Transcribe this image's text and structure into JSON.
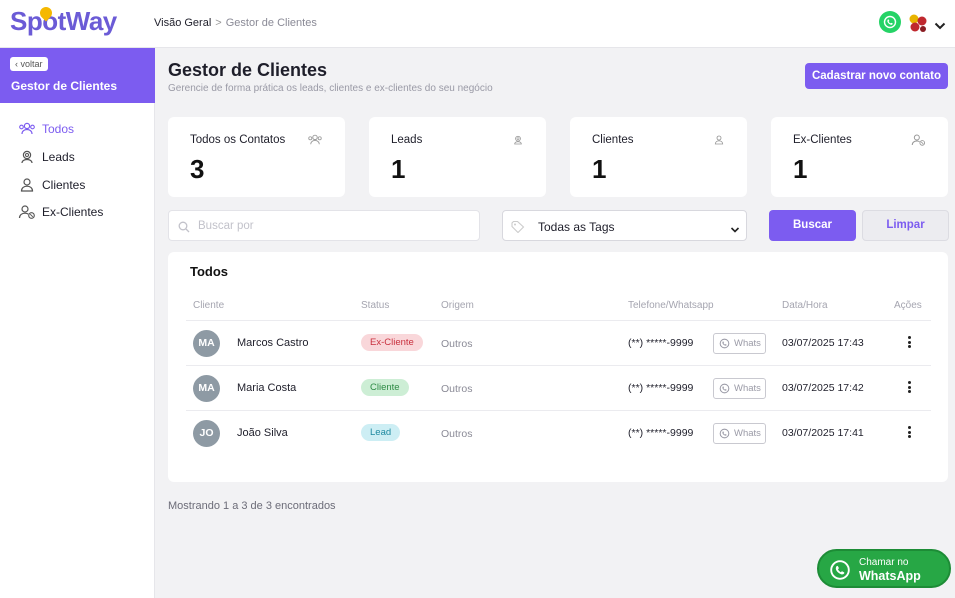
{
  "brand": {
    "logo_spot": "Spot",
    "logo_way": "Way"
  },
  "breadcrumb": {
    "root": "Visão Geral",
    "separator": ">",
    "current": "Gestor de Clientes"
  },
  "sidebar": {
    "back_label": "voltar",
    "title": "Gestor de Clientes",
    "items": [
      {
        "label": "Todos",
        "icon": "users-icon",
        "active": true
      },
      {
        "label": "Leads",
        "icon": "lead-icon",
        "active": false
      },
      {
        "label": "Clientes",
        "icon": "user-icon",
        "active": false
      },
      {
        "label": "Ex-Clientes",
        "icon": "user-x-icon",
        "active": false
      }
    ]
  },
  "header": {
    "title": "Gestor de Clientes",
    "subtitle": "Gerencie de forma prática os leads, clientes e ex-clientes do seu negócio",
    "new_contact_label": "Cadastrar novo contato"
  },
  "stats": [
    {
      "label": "Todos os Contatos",
      "value": "3",
      "icon": "users-icon"
    },
    {
      "label": "Leads",
      "value": "1",
      "icon": "lead-icon"
    },
    {
      "label": "Clientes",
      "value": "1",
      "icon": "user-icon"
    },
    {
      "label": "Ex-Clientes",
      "value": "1",
      "icon": "user-x-icon"
    }
  ],
  "filters": {
    "search_placeholder": "Buscar por",
    "search_value": "",
    "tags_selected": "Todas as Tags",
    "search_button": "Buscar",
    "clear_button": "Limpar"
  },
  "table": {
    "title": "Todos",
    "columns": [
      "Cliente",
      "Status",
      "Origem",
      "Telefone/Whatsapp",
      "Data/Hora",
      "Ações"
    ],
    "rows": [
      {
        "initials": "MA",
        "name": "Marcos Castro",
        "status": "Ex-Cliente",
        "origem": "Outros",
        "phone": "(**) *****-9999",
        "whats": "Whats",
        "datetime": "03/07/2025 17:43"
      },
      {
        "initials": "MA",
        "name": "Maria Costa",
        "status": "Cliente",
        "origem": "Outros",
        "phone": "(**) *****-9999",
        "whats": "Whats",
        "datetime": "03/07/2025 17:42"
      },
      {
        "initials": "JO",
        "name": "João Silva",
        "status": "Lead",
        "origem": "Outros",
        "phone": "(**) *****-9999",
        "whats": "Whats",
        "datetime": "03/07/2025 17:41"
      }
    ]
  },
  "status_colors": {
    "Ex-Cliente": {
      "bg": "#f9d7da",
      "fg": "#c9303e"
    },
    "Cliente": {
      "bg": "#cdeed5",
      "fg": "#2e8b45"
    },
    "Lead": {
      "bg": "#cdeef4",
      "fg": "#1f8aa0"
    }
  },
  "pagination": {
    "summary": "Mostrando 1 a 3 de 3 encontrados"
  },
  "whatsapp_float": {
    "line1": "Chamar no",
    "line2": "WhatsApp"
  },
  "colors": {
    "accent": "#7c5cf0",
    "whatsapp": "#25d366"
  }
}
